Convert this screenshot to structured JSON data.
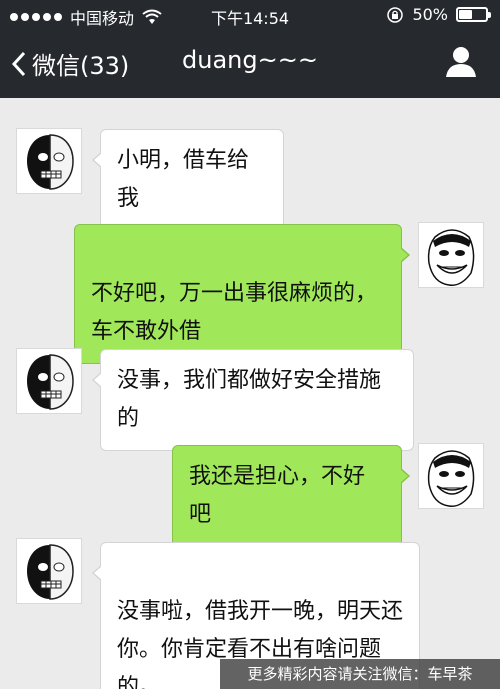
{
  "status_bar": {
    "carrier": "中国移动",
    "time": "下午14:54",
    "battery_percent": "50%",
    "battery_level": 0.5,
    "icons": [
      "signal-dots-icon",
      "wifi-icon",
      "rotation-lock-icon",
      "battery-icon"
    ]
  },
  "nav": {
    "back_label": "微信(33)",
    "title": "duang~~~",
    "profile_icon": "person-icon"
  },
  "messages": [
    {
      "side": "left",
      "text": "小明，借车给我"
    },
    {
      "side": "right",
      "text": "不好吧，万一出事很麻烦的，\n车不敢外借"
    },
    {
      "side": "left",
      "text": "没事，我们都做好安全措施的"
    },
    {
      "side": "right",
      "text": "我还是担心，不好吧"
    },
    {
      "side": "left",
      "text": "没事啦，借我开一晚，明天还\n你。你肯定看不出有啥问题\n的。"
    }
  ],
  "watermark": "更多精彩内容请关注微信：车早茶",
  "colors": {
    "header_bg": "#26292e",
    "chat_bg": "#ebebeb",
    "bubble_self": "#a0e75a",
    "bubble_other": "#ffffff"
  }
}
